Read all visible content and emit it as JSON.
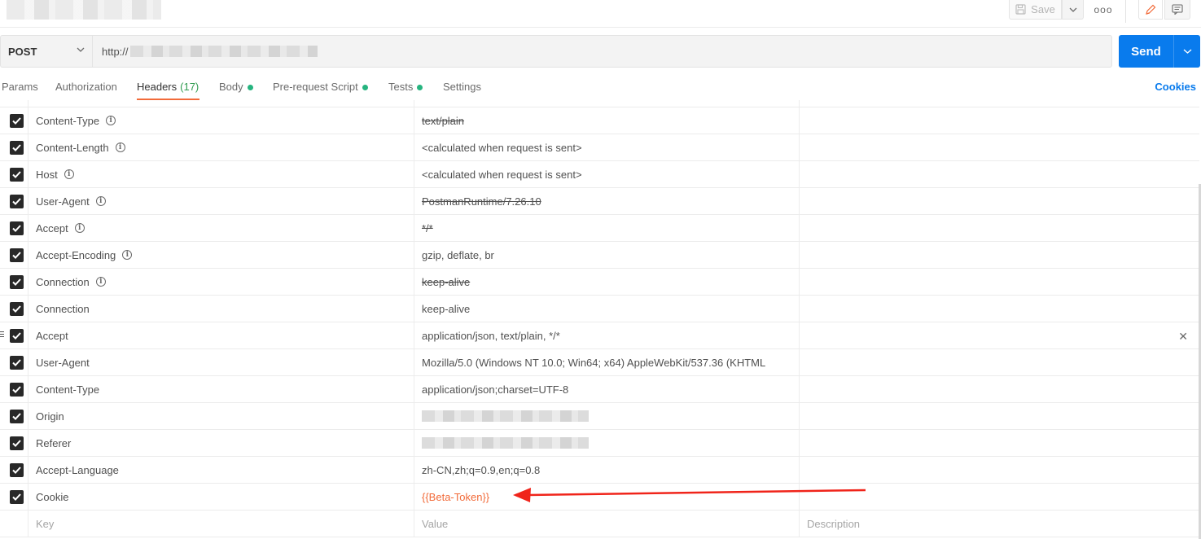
{
  "toolbar": {
    "save_label": "Save",
    "more_label": "ooo",
    "icons": [
      "save-icon",
      "chevron-down-icon",
      "more-icon",
      "pencil-icon",
      "comment-icon"
    ]
  },
  "request": {
    "method": "POST",
    "url_prefix": "http://",
    "send_label": "Send"
  },
  "tabs": [
    {
      "label": "Params"
    },
    {
      "label": "Authorization"
    },
    {
      "label": "Headers",
      "count": "(17)",
      "active": true
    },
    {
      "label": "Body",
      "dot": true
    },
    {
      "label": "Pre-request Script",
      "dot": true
    },
    {
      "label": "Tests",
      "dot": true
    },
    {
      "label": "Settings"
    }
  ],
  "cookies_label": "Cookies",
  "headers": {
    "rows": [
      {
        "key": "Content-Type",
        "value": "text/plain"
      },
      {
        "key": "Content-Length",
        "value": "<calculated when request is sent>"
      },
      {
        "key": "Host",
        "value": "<calculated when request is sent>"
      },
      {
        "key": "User-Agent",
        "value": "PostmanRuntime/7.26.10"
      },
      {
        "key": "Accept",
        "value": "*/*"
      },
      {
        "key": "Accept-Encoding",
        "value": "gzip, deflate, br"
      },
      {
        "key": "Connection",
        "value": "keep-alive"
      },
      {
        "key": "Connection",
        "value": "keep-alive"
      },
      {
        "key": "Accept",
        "value": "application/json, text/plain, */*"
      },
      {
        "key": "User-Agent",
        "value": "Mozilla/5.0 (Windows NT 10.0; Win64; x64) AppleWebKit/537.36 (KHTML"
      },
      {
        "key": "Content-Type",
        "value": "application/json;charset=UTF-8"
      },
      {
        "key": "Origin",
        "value": ""
      },
      {
        "key": "Referer",
        "value": ""
      },
      {
        "key": "Accept-Language",
        "value": "zh-CN,zh;q=0.9,en;q=0.8"
      },
      {
        "key": "Cookie",
        "value": "{{Beta-Token}}"
      }
    ],
    "placeholders": {
      "key": "Key",
      "value": "Value",
      "description": "Description"
    }
  },
  "colors": {
    "send": "#097bed",
    "active_tab_underline": "#f26b3a",
    "variable": "#f26b3a",
    "dot": "#26b47f",
    "annotation_arrow": "#f0241a"
  }
}
